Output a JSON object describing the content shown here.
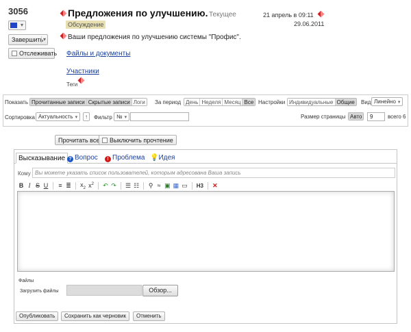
{
  "task": {
    "id": "3056",
    "title": "Предложения по улучшению.",
    "status": "Текущее",
    "badge": "Обсуждение",
    "created": "21 апрель в 09:11",
    "deadline": "29.06.2011",
    "description": "Ваши предложения по улучшению системы \"Профис\".",
    "files_link": "Файлы и документы",
    "participants_link": "Участники",
    "tags_label": "Теги",
    "color": "#2245c8"
  },
  "actions": {
    "finish_label": "Завершить",
    "watch_label": "Отслеживать"
  },
  "filters": {
    "show_label": "Показать",
    "show_options": [
      "Прочитанные записи",
      "Скрытые записи",
      "Логи"
    ],
    "period_label": "За период",
    "period_options": [
      "День",
      "Неделя",
      "Месяц",
      "Все"
    ],
    "settings_label": "Настройки",
    "settings_options": [
      "Индивидуальные",
      "Общие"
    ],
    "view_label": "Вид",
    "view_value": "Линейно",
    "sort_label": "Сортировка",
    "sort_value": "Актуальность",
    "filter_label": "Фильтр",
    "filter_value": "№",
    "page_size_label": "Размер страницы",
    "page_size_mode": "Авто",
    "page_size_value": "9",
    "total_label": "всего 6"
  },
  "read_controls": {
    "read_all": "Прочитать все",
    "disable_reading": "Выключить прочтение"
  },
  "editor": {
    "tabs": [
      "Высказывание",
      "Вопрос",
      "Проблема",
      "Идея"
    ],
    "to_label": "Кому",
    "to_placeholder": "Вы можете указать список пользователей, которым адресована Ваша запись",
    "files_label": "Файлы",
    "upload_label": "Загрузить файлы",
    "browse_label": "Обзор...",
    "publish_label": "Опубликовать",
    "save_draft_label": "Сохранить как черновик",
    "cancel_label": "Отменить"
  }
}
